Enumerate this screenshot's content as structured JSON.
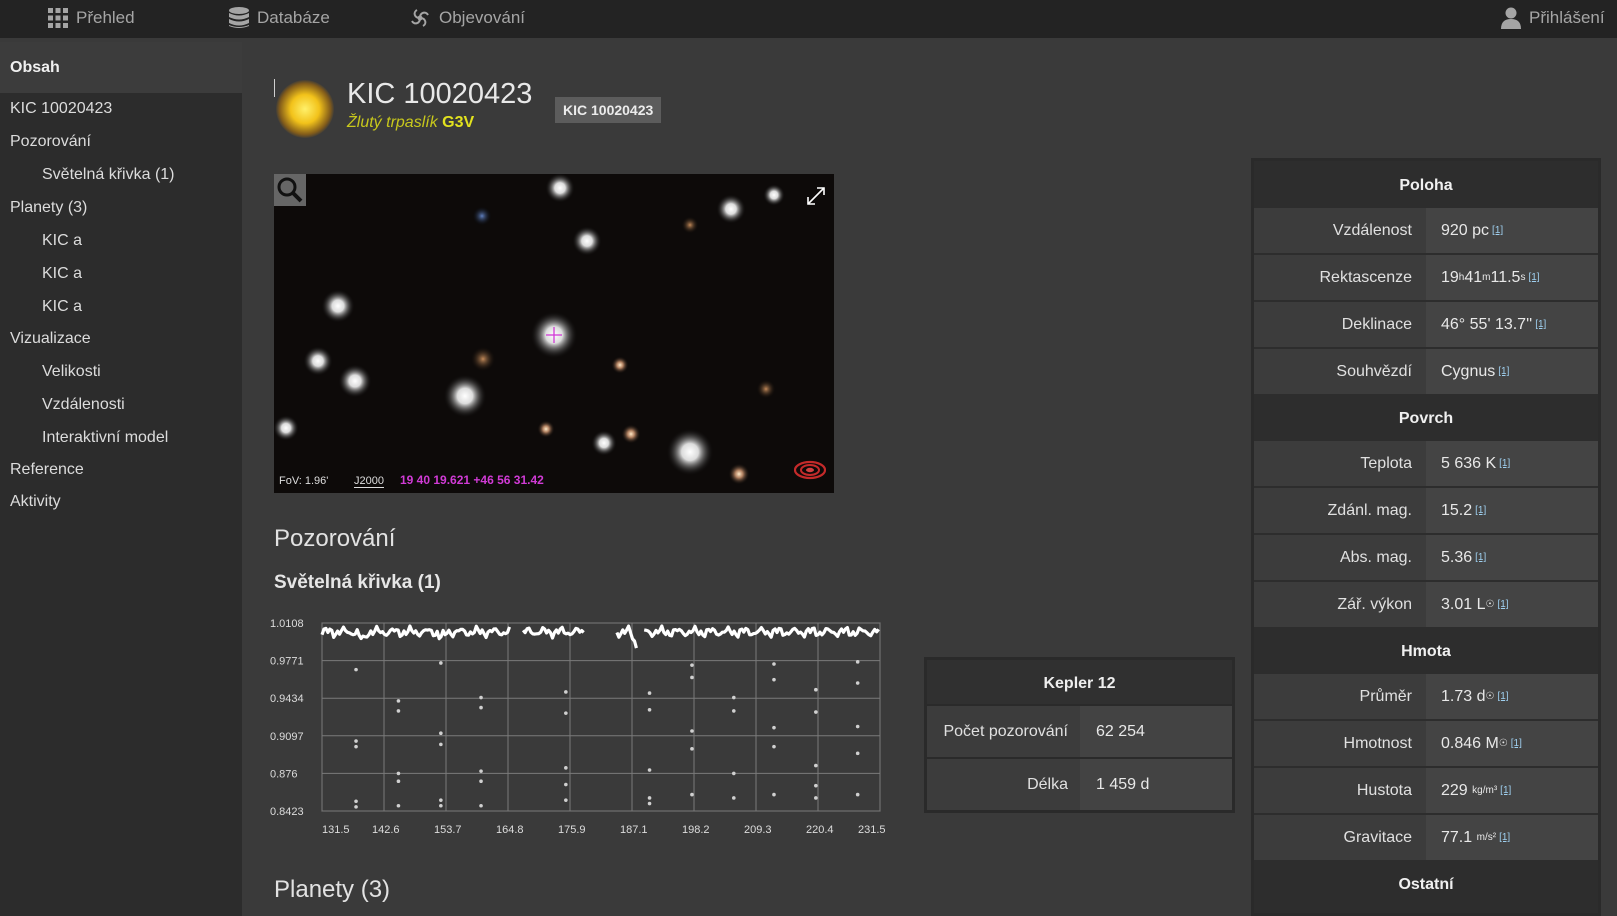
{
  "topbar": {
    "overview": "Přehled",
    "database": "Databáze",
    "discovery": "Objevování",
    "login": "Přihlášení"
  },
  "sidebar": {
    "heading": "Obsah",
    "items": [
      {
        "label": "KIC 10020423",
        "sub": false
      },
      {
        "label": "Pozorování",
        "sub": false
      },
      {
        "label": "Světelná křivka (1)",
        "sub": true
      },
      {
        "label": "Planety (3)",
        "sub": false
      },
      {
        "label": "KIC a",
        "sub": true
      },
      {
        "label": "KIC a",
        "sub": true
      },
      {
        "label": "KIC a",
        "sub": true
      },
      {
        "label": "Vizualizace",
        "sub": false
      },
      {
        "label": "Velikosti",
        "sub": true
      },
      {
        "label": "Vzdálenosti",
        "sub": true
      },
      {
        "label": "Interaktivní model",
        "sub": true
      },
      {
        "label": "Reference",
        "sub": false
      },
      {
        "label": "Aktivity",
        "sub": false
      }
    ]
  },
  "object": {
    "name": "KIC 10020423",
    "type": "Žlutý trpaslík",
    "spectral": "G3V",
    "badge": "KIC 10020423"
  },
  "sky": {
    "fov": "FoV: 1.96'",
    "epoch": "J2000",
    "coords": "19 40 19.621 +46 56 31.42"
  },
  "sections": {
    "observations": "Pozorování",
    "lightcurve": "Světelná křivka (1)",
    "planets": "Planety (3)"
  },
  "chart_data": {
    "type": "scatter",
    "title": "",
    "xlabel": "",
    "ylabel": "",
    "x_ticks": [
      "131.5",
      "142.6",
      "153.7",
      "164.8",
      "175.9",
      "187.1",
      "198.2",
      "209.3",
      "220.4",
      "231.5"
    ],
    "y_ticks": [
      "1.0108",
      "0.9771",
      "0.9434",
      "0.9097",
      "0.876",
      "0.8423"
    ],
    "xlim": [
      131.5,
      231.5
    ],
    "ylim": [
      0.8423,
      1.0108
    ],
    "grid": true,
    "gaps": [
      [
        165.3,
        167.5
      ],
      [
        178.5,
        184.0
      ],
      [
        188.0,
        189.0
      ]
    ],
    "outliers": [
      [
        137.6,
        0.969
      ],
      [
        137.6,
        0.9
      ],
      [
        137.6,
        0.905
      ],
      [
        137.6,
        0.851
      ],
      [
        137.6,
        0.846
      ],
      [
        145.2,
        0.941
      ],
      [
        145.2,
        0.932
      ],
      [
        145.2,
        0.876
      ],
      [
        145.2,
        0.869
      ],
      [
        145.2,
        0.847
      ],
      [
        152.8,
        0.975
      ],
      [
        152.8,
        0.912
      ],
      [
        152.8,
        0.902
      ],
      [
        152.8,
        0.852
      ],
      [
        152.8,
        0.847
      ],
      [
        160.0,
        0.944
      ],
      [
        160.0,
        0.935
      ],
      [
        160.0,
        0.878
      ],
      [
        160.0,
        0.869
      ],
      [
        160.0,
        0.847
      ],
      [
        175.2,
        0.949
      ],
      [
        175.2,
        0.93
      ],
      [
        175.2,
        0.881
      ],
      [
        175.2,
        0.866
      ],
      [
        175.2,
        0.852
      ],
      [
        190.2,
        0.948
      ],
      [
        190.2,
        0.933
      ],
      [
        190.2,
        0.879
      ],
      [
        190.2,
        0.854
      ],
      [
        190.2,
        0.849
      ],
      [
        197.8,
        0.973
      ],
      [
        197.8,
        0.962
      ],
      [
        197.8,
        0.914
      ],
      [
        197.8,
        0.898
      ],
      [
        197.8,
        0.857
      ],
      [
        205.3,
        0.944
      ],
      [
        205.3,
        0.932
      ],
      [
        205.3,
        0.876
      ],
      [
        205.3,
        0.854
      ],
      [
        212.5,
        0.974
      ],
      [
        212.5,
        0.96
      ],
      [
        212.5,
        0.917
      ],
      [
        212.5,
        0.9
      ],
      [
        212.5,
        0.857
      ],
      [
        220.0,
        0.951
      ],
      [
        220.0,
        0.931
      ],
      [
        220.0,
        0.883
      ],
      [
        220.0,
        0.865
      ],
      [
        220.0,
        0.854
      ],
      [
        227.5,
        0.976
      ],
      [
        227.5,
        0.957
      ],
      [
        227.5,
        0.918
      ],
      [
        227.5,
        0.894
      ],
      [
        227.5,
        0.857
      ]
    ]
  },
  "kepler": {
    "title": "Kepler 12",
    "rows": [
      {
        "label": "Počet pozorování",
        "value": "62 254"
      },
      {
        "label": "Délka",
        "value": "1 459 d"
      }
    ]
  },
  "info": {
    "location": {
      "heading": "Poloha",
      "distance_label": "Vzdálenost",
      "distance": "920 pc",
      "ra_label": "Rektascenze",
      "ra_h": "19",
      "ra_hu": "h",
      "ra_m": "41",
      "ra_mu": "m",
      "ra_s": "11.5",
      "ra_su": "s",
      "dec_label": "Deklinace",
      "dec": "46° 55' 13.7''",
      "const_label": "Souhvězdí",
      "const": "Cygnus"
    },
    "surface": {
      "heading": "Povrch",
      "temp_label": "Teplota",
      "temp": "5 636 K",
      "appmag_label": "Zdánl. mag.",
      "appmag": "15.2",
      "absmag_label": "Abs. mag.",
      "absmag": "5.36",
      "lum_label": "Zář. výkon",
      "lum": "3.01 L",
      "lum_sub": "☉"
    },
    "mass": {
      "heading": "Hmota",
      "diam_label": "Průměr",
      "diam": "1.73 d",
      "diam_sub": "☉",
      "mass_label": "Hmotnost",
      "mass": "0.846 M",
      "mass_sub": "☉",
      "dens_label": "Hustota",
      "dens": "229",
      "dens_num": "kg",
      "dens_den": "m³",
      "grav_label": "Gravitace",
      "grav": "77.1",
      "grav_num": "m",
      "grav_den": "s²"
    },
    "other": {
      "heading": "Ostatní"
    },
    "ref": "[1]"
  }
}
